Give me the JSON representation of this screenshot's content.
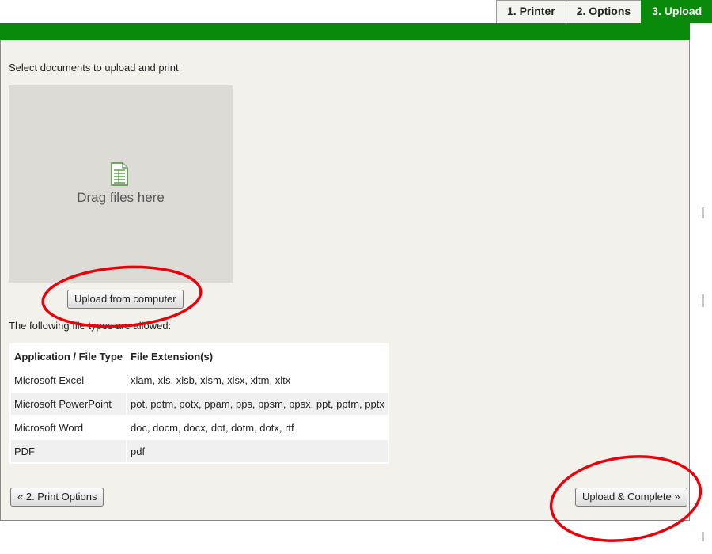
{
  "wizard": {
    "tabs": [
      {
        "label": "1. Printer",
        "active": false
      },
      {
        "label": "2. Options",
        "active": false
      },
      {
        "label": "3. Upload",
        "active": true
      }
    ],
    "accent_color": "#0a8a0a"
  },
  "upload": {
    "instruction": "Select documents to upload and print",
    "drop_zone_text": "Drag files here",
    "drop_zone_icon": "document-icon",
    "upload_button_label": "Upload from computer"
  },
  "file_types": {
    "intro": "The following file types are allowed:",
    "headers": [
      "Application / File Type",
      "File Extension(s)"
    ],
    "rows": [
      {
        "type": "Microsoft Excel",
        "extensions": "xlam, xls, xlsb, xlsm, xlsx, xltm, xltx"
      },
      {
        "type": "Microsoft PowerPoint",
        "extensions": "pot, potm, potx, ppam, pps, ppsm, ppsx, ppt, pptm, pptx"
      },
      {
        "type": "Microsoft Word",
        "extensions": "doc, docm, docx, dot, dotm, dotx, rtf"
      },
      {
        "type": "PDF",
        "extensions": "pdf"
      }
    ]
  },
  "footer": {
    "back_label": "« 2. Print Options",
    "complete_label": "Upload & Complete »"
  },
  "annotation_color": "#e8000b"
}
